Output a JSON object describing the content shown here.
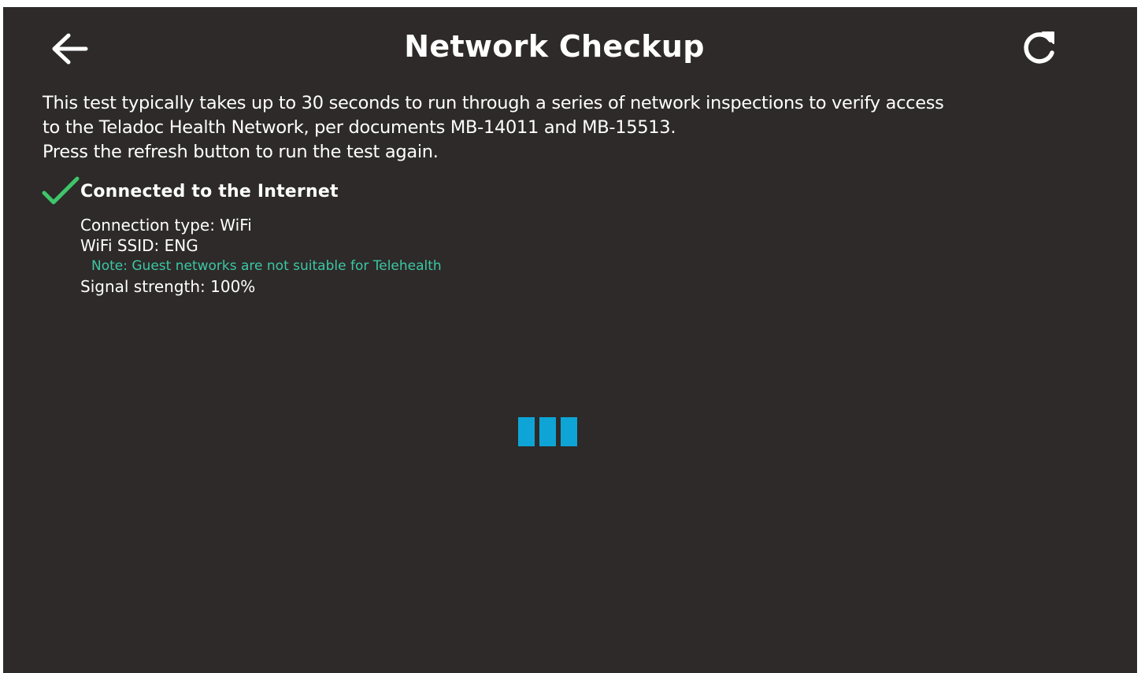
{
  "header": {
    "title": "Network Checkup",
    "back_icon": "arrow-left-icon",
    "refresh_icon": "refresh-icon"
  },
  "description": {
    "line1": "This test typically takes up to 30 seconds to run through a series of network inspections to verify access",
    "line2": "to the Teladoc Health Network, per documents MB-14011 and MB-15513.",
    "line3": "Press the refresh button to run the test again."
  },
  "status": {
    "icon": "checkmark-icon",
    "label": "Connected to the Internet"
  },
  "details": {
    "connection_type": "Connection type: WiFi",
    "ssid": "WiFi SSID: ENG",
    "note": "Note: Guest networks are not suitable for Telehealth",
    "signal": "Signal strength: 100%"
  },
  "spinner_icon": "loading-bars-icon",
  "colors": {
    "background": "#2d2a29",
    "text": "#ffffff",
    "check": "#3ec66a",
    "note": "#3cc7a4",
    "spinner": "#0ea5d6"
  }
}
